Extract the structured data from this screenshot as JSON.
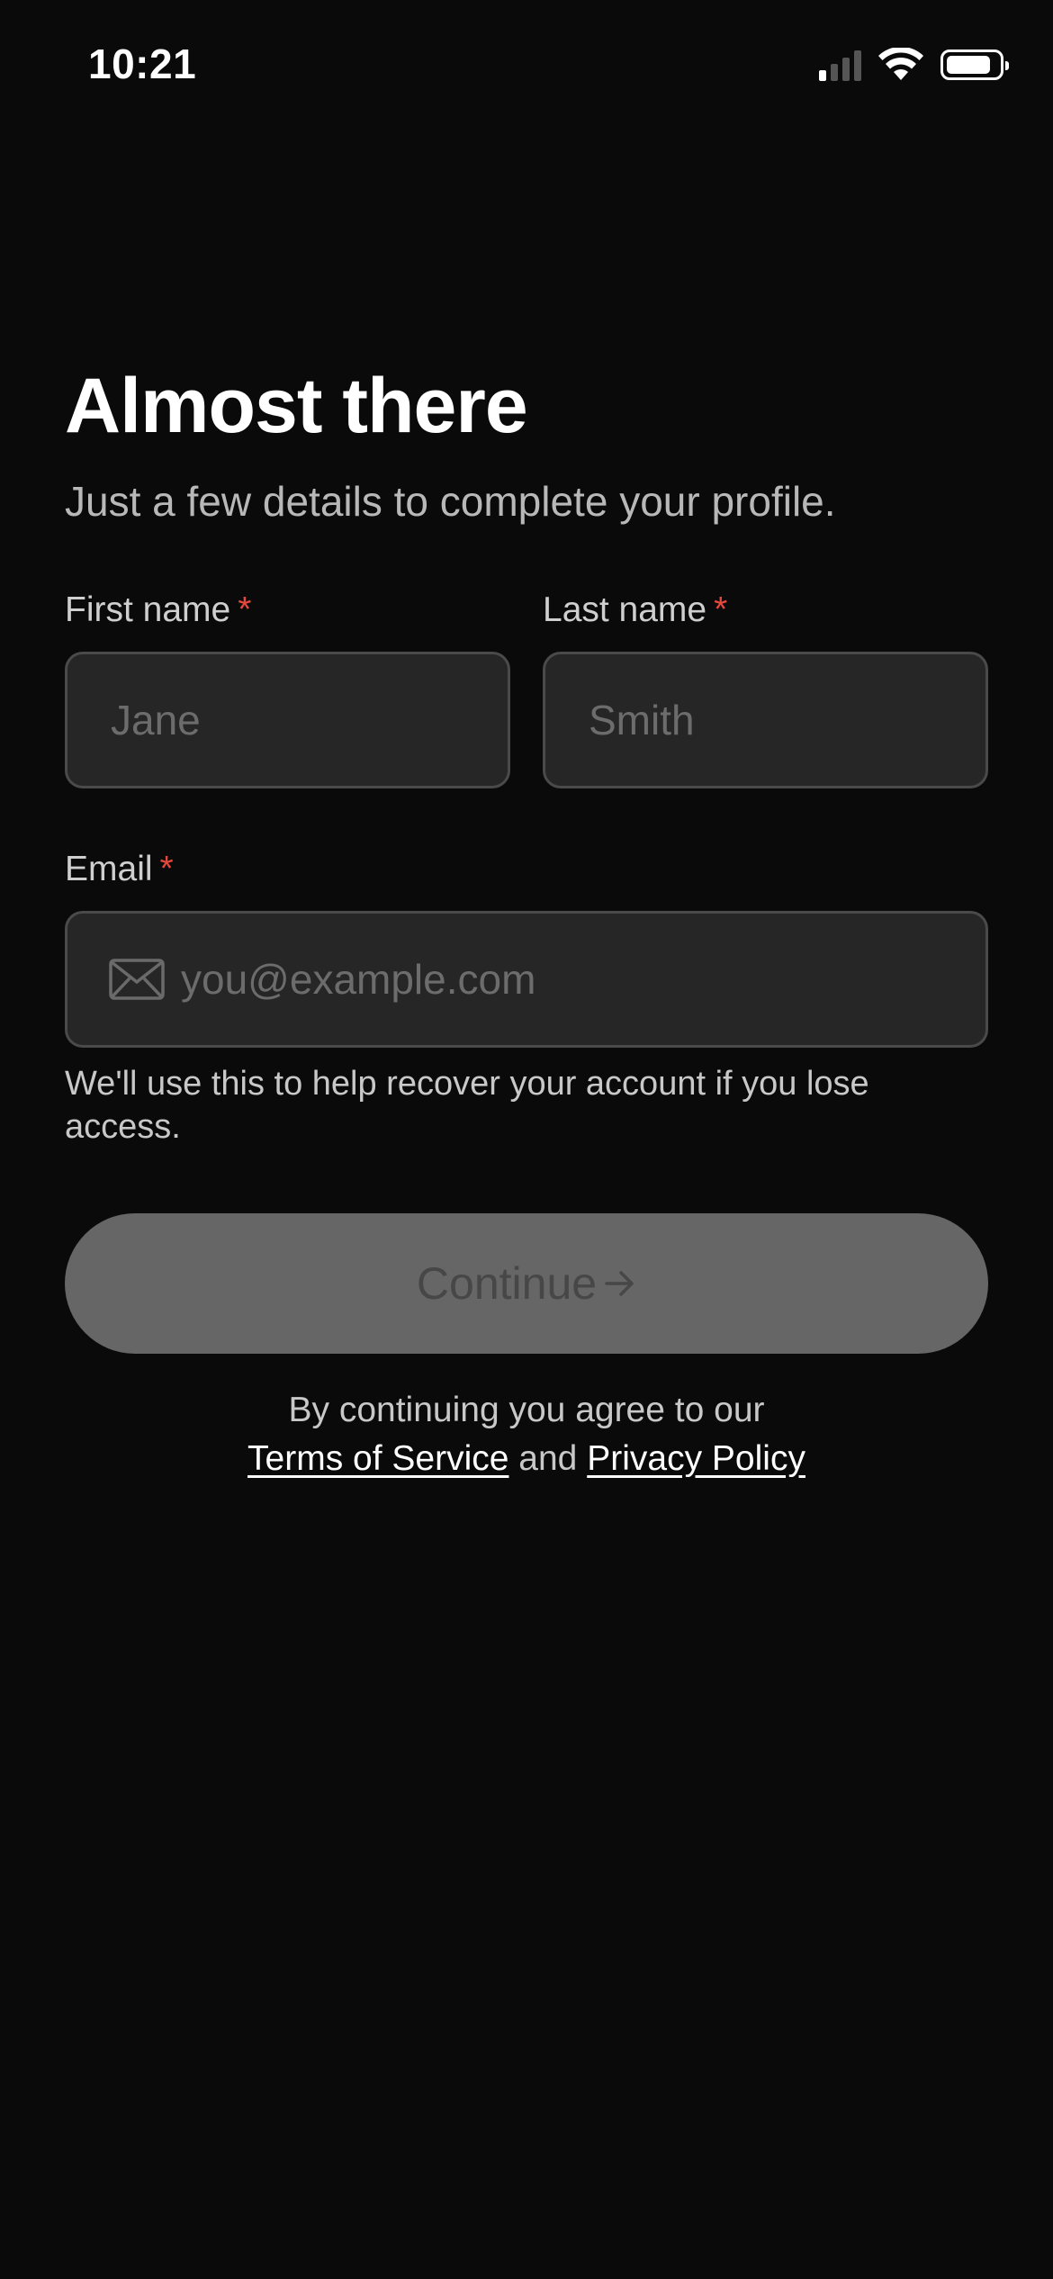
{
  "status_bar": {
    "time": "10:21",
    "icons": [
      "signal-icon",
      "wifi-icon",
      "battery-icon"
    ]
  },
  "header": {
    "title": "Almost there",
    "subtitle": "Just a few details to complete your profile."
  },
  "form": {
    "first_name": {
      "label": "First name",
      "required_mark": "*",
      "placeholder": "Jane",
      "value": ""
    },
    "last_name": {
      "label": "Last name",
      "required_mark": "*",
      "placeholder": "Smith",
      "value": ""
    },
    "email": {
      "label": "Email",
      "required_mark": "*",
      "placeholder": "you@example.com",
      "value": "",
      "icon": "mail-icon"
    },
    "email_helper": "We'll use this to help recover your account if you lose access."
  },
  "continue_button": {
    "label": "Continue",
    "icon": "arrow-right-icon",
    "disabled": true
  },
  "legal": {
    "prefix": "By continuing you agree to our",
    "terms_link": "Terms of Service",
    "conjunction": "and",
    "privacy_link": "Privacy Policy"
  },
  "colors": {
    "background": "#0a0a0a",
    "field_background": "#262626",
    "field_border": "#4a4a4a",
    "required": "#e5483c",
    "button_disabled": "#666666",
    "button_text_disabled": "#474747"
  }
}
